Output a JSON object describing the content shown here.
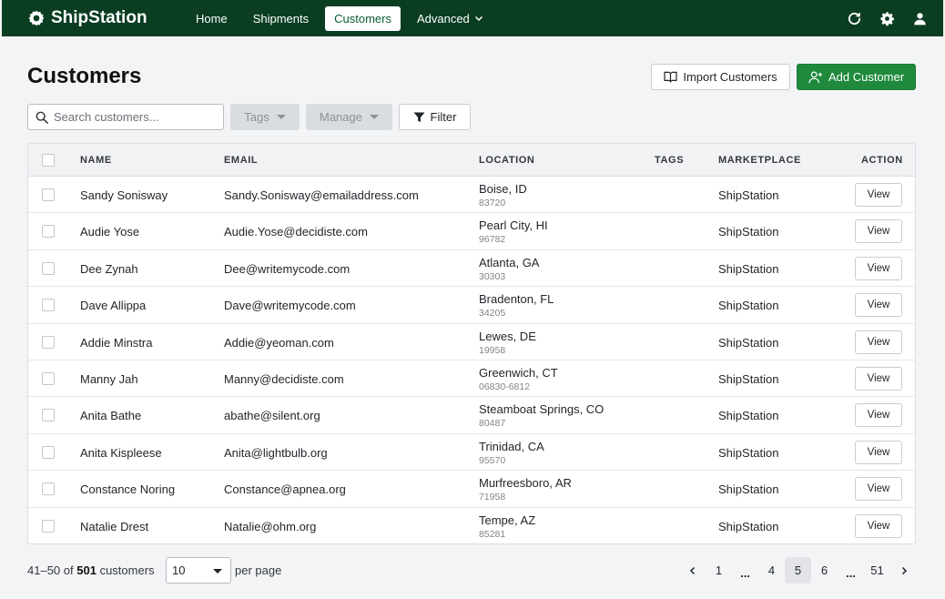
{
  "nav": {
    "brand": "ShipStation",
    "links": [
      {
        "label": "Home",
        "active": false
      },
      {
        "label": "Shipments",
        "active": false
      },
      {
        "label": "Customers",
        "active": true
      },
      {
        "label": "Advanced",
        "active": false
      }
    ],
    "icons": [
      "refresh-icon",
      "gear-icon",
      "user-icon"
    ]
  },
  "page": {
    "title": "Customers",
    "import_label": "Import Customers",
    "add_label": "Add Customer"
  },
  "toolbar": {
    "search_placeholder": "Search customers...",
    "tags_label": "Tags",
    "manage_label": "Manage",
    "filter_label": "Filter"
  },
  "table": {
    "columns": {
      "name": "NAME",
      "email": "EMAIL",
      "location": "LOCATION",
      "tags": "TAGS",
      "marketplace": "MARKETPLACE",
      "action": "ACTION"
    },
    "view_label": "View",
    "rows": [
      {
        "name": "Sandy Sonisway",
        "email": "Sandy.Sonisway@emailaddress.com",
        "location": "Boise, ID",
        "zip": "83720",
        "tags": "",
        "marketplace": "ShipStation"
      },
      {
        "name": "Audie Yose",
        "email": "Audie.Yose@decidiste.com",
        "location": "Pearl City, HI",
        "zip": "96782",
        "tags": "",
        "marketplace": "ShipStation"
      },
      {
        "name": "Dee Zynah",
        "email": "Dee@writemycode.com",
        "location": "Atlanta, GA",
        "zip": "30303",
        "tags": "",
        "marketplace": "ShipStation"
      },
      {
        "name": "Dave Allippa",
        "email": "Dave@writemycode.com",
        "location": "Bradenton, FL",
        "zip": "34205",
        "tags": "",
        "marketplace": "ShipStation"
      },
      {
        "name": "Addie Minstra",
        "email": "Addie@yeoman.com",
        "location": "Lewes, DE",
        "zip": "19958",
        "tags": "",
        "marketplace": "ShipStation"
      },
      {
        "name": "Manny Jah",
        "email": "Manny@decidiste.com",
        "location": "Greenwich, CT",
        "zip": "06830-6812",
        "tags": "",
        "marketplace": "ShipStation"
      },
      {
        "name": "Anita Bathe",
        "email": "abathe@silent.org",
        "location": "Steamboat Springs, CO",
        "zip": "80487",
        "tags": "",
        "marketplace": "ShipStation"
      },
      {
        "name": "Anita Kispleese",
        "email": "Anita@lightbulb.org",
        "location": "Trinidad, CA",
        "zip": "95570",
        "tags": "",
        "marketplace": "ShipStation"
      },
      {
        "name": "Constance Noring",
        "email": "Constance@apnea.org",
        "location": "Murfreesboro, AR",
        "zip": "71958",
        "tags": "",
        "marketplace": "ShipStation"
      },
      {
        "name": "Natalie Drest",
        "email": "Natalie@ohm.org",
        "location": "Tempe, AZ",
        "zip": "85281",
        "tags": "",
        "marketplace": "ShipStation"
      }
    ]
  },
  "footer": {
    "range": "41–50",
    "of_text": "of",
    "total": "501",
    "unit": "customers",
    "per_page_value": "10",
    "per_page_label": "per page"
  },
  "pagination": {
    "pages": [
      "1",
      "...",
      "4",
      "5",
      "6",
      "...",
      "51"
    ],
    "current": "5"
  },
  "colors": {
    "nav_bg": "#0a3d22",
    "accent_green": "#1f8a3c"
  }
}
